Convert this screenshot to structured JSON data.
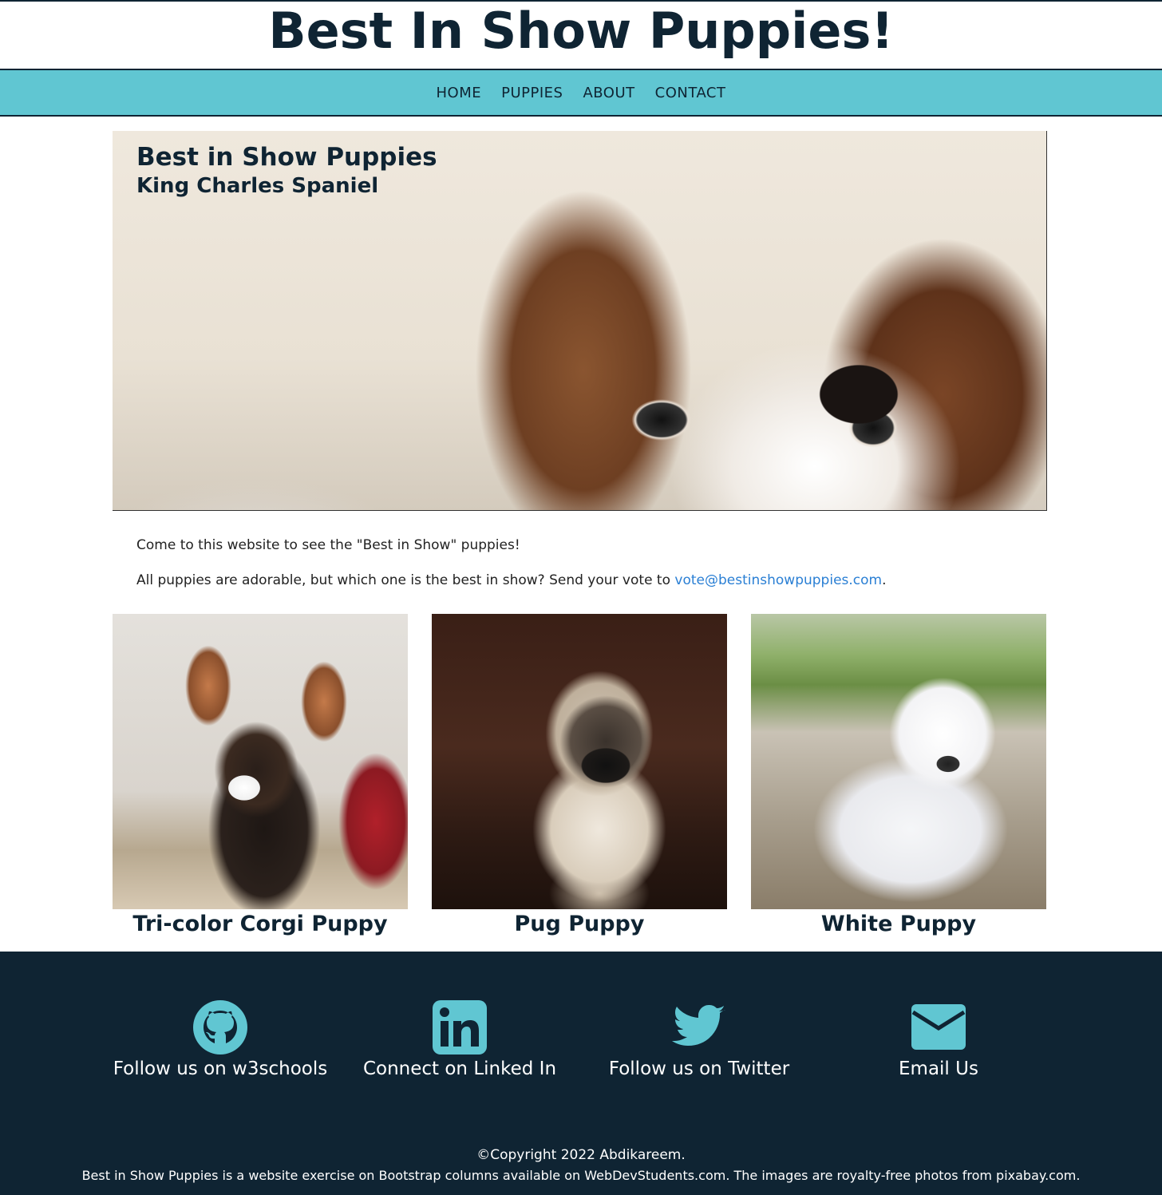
{
  "header": {
    "title": "Best In Show Puppies!"
  },
  "nav": {
    "items": [
      {
        "label": "HOME"
      },
      {
        "label": "PUPPIES"
      },
      {
        "label": "ABOUT"
      },
      {
        "label": "CONTACT"
      }
    ]
  },
  "hero": {
    "title": "Best in Show Puppies",
    "subtitle": "King Charles Spaniel"
  },
  "intro": {
    "line1": "Come to this website to see the \"Best in Show\" puppies!",
    "line2_prefix": "All puppies are adorable, but which one is the best in show? Send your vote to ",
    "email": "vote@bestinshowpuppies.com",
    "line2_suffix": "."
  },
  "puppies": [
    {
      "name": "Tri-color Corgi Puppy"
    },
    {
      "name": "Pug Puppy"
    },
    {
      "name": "White Puppy"
    }
  ],
  "footer": {
    "social": [
      {
        "label": "Follow us on w3schools",
        "icon": "github-icon"
      },
      {
        "label": "Connect on Linked In",
        "icon": "linkedin-icon"
      },
      {
        "label": "Follow us on Twitter",
        "icon": "twitter-icon"
      },
      {
        "label": "Email Us",
        "icon": "envelope-icon"
      }
    ],
    "copyright": "©Copyright 2022 Abdikareem.",
    "credits": "Best in Show Puppies is a website exercise on Bootstrap columns available on WebDevStudents.com. The images are royalty-free photos from pixabay.com."
  },
  "colors": {
    "navy": "#0f2433",
    "teal": "#60c6d2",
    "link": "#2a7fd4"
  }
}
